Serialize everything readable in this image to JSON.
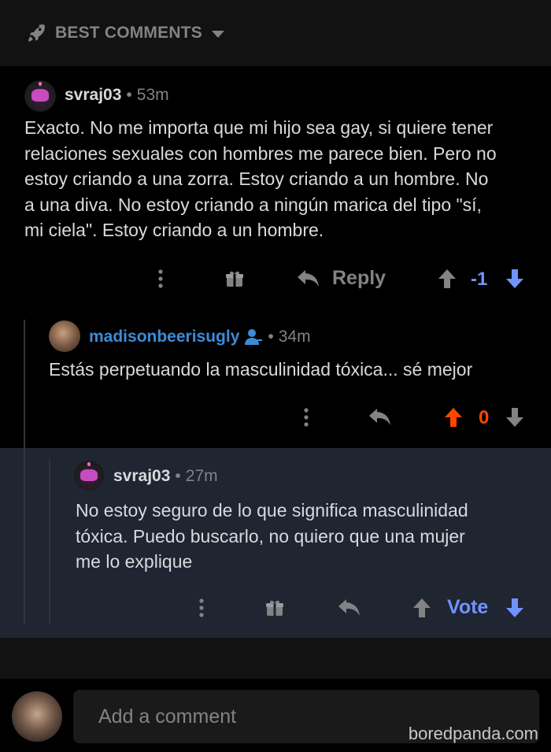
{
  "sort": {
    "label": "BEST COMMENTS"
  },
  "comments": [
    {
      "username": "svraj03",
      "time": "53m",
      "lines": [
        "Exacto. No me importa que mi hijo sea gay, si quiere tener",
        "relaciones sexuales con hombres me parece bien. Pero no",
        "estoy criando a una zorra. Estoy criando a un hombre. No",
        "a una diva. No estoy criando a ningún marica del tipo \"sí,",
        "mi ciela\". Estoy criando a un hombre."
      ],
      "reply_label": "Reply",
      "score": "-1",
      "score_color": "#7193ff"
    },
    {
      "username": "madisonbeerisugly",
      "username_color": "#3d8bd6",
      "time": "34m",
      "lines": [
        "Estás perpetuando la masculinidad tóxica... sé mejor"
      ],
      "score": "0",
      "score_color": "#ff4500"
    },
    {
      "username": "svraj03",
      "time": "27m",
      "lines": [
        "No estoy seguro de lo que significa masculinidad",
        "tóxica. Puedo buscarlo, no quiero que una mujer",
        "me lo explique"
      ],
      "score": "Vote",
      "score_color": "#7193ff"
    }
  ],
  "composer": {
    "placeholder": "Add a comment"
  },
  "watermark": "boredpanda.com"
}
